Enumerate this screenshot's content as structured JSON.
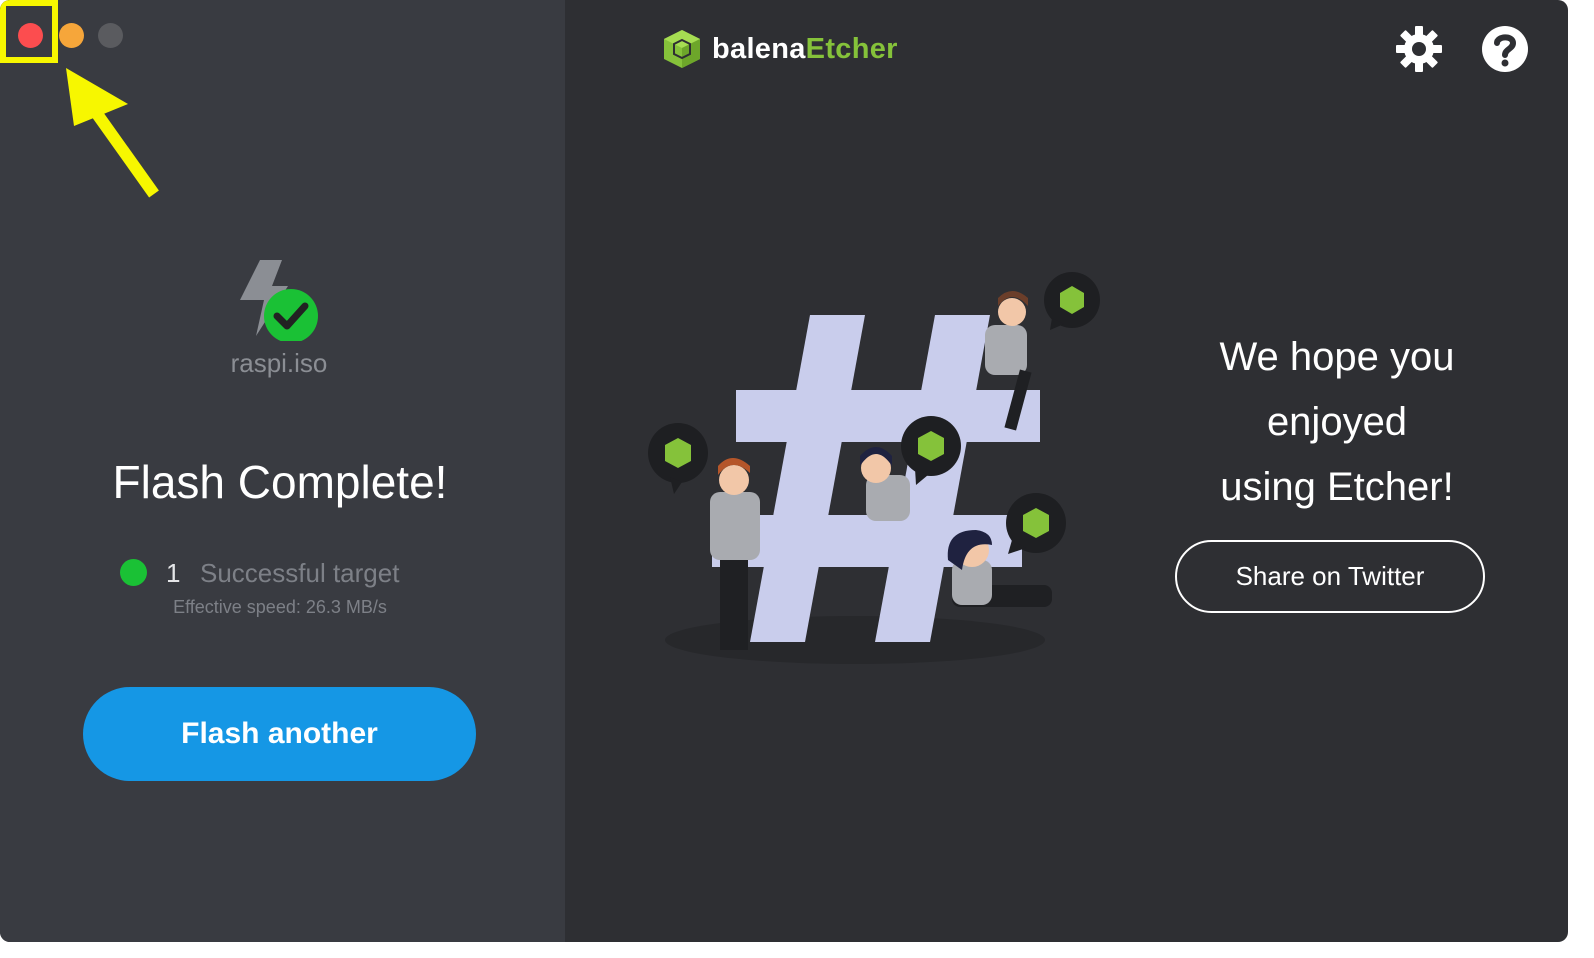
{
  "window": {
    "buttons": [
      "close",
      "minimize",
      "zoom"
    ]
  },
  "left": {
    "file_name": "raspi.iso",
    "status_title": "Flash Complete!",
    "result": {
      "count": "1",
      "label": "Successful target"
    },
    "speed": "Effective speed: 26.3 MB/s",
    "flash_button": "Flash another"
  },
  "header": {
    "logo_part1": "balena",
    "logo_part2": "Etcher",
    "icons": [
      "gear-icon",
      "help-icon"
    ]
  },
  "right": {
    "message_lines": [
      "We hope you",
      "enjoyed",
      "using Etcher!"
    ],
    "share_button": "Share on Twitter"
  },
  "colors": {
    "accent_blue": "#1597e5",
    "success_green": "#1ac135",
    "brand_green": "#85c23a",
    "annotation_yellow": "#f7f700"
  }
}
